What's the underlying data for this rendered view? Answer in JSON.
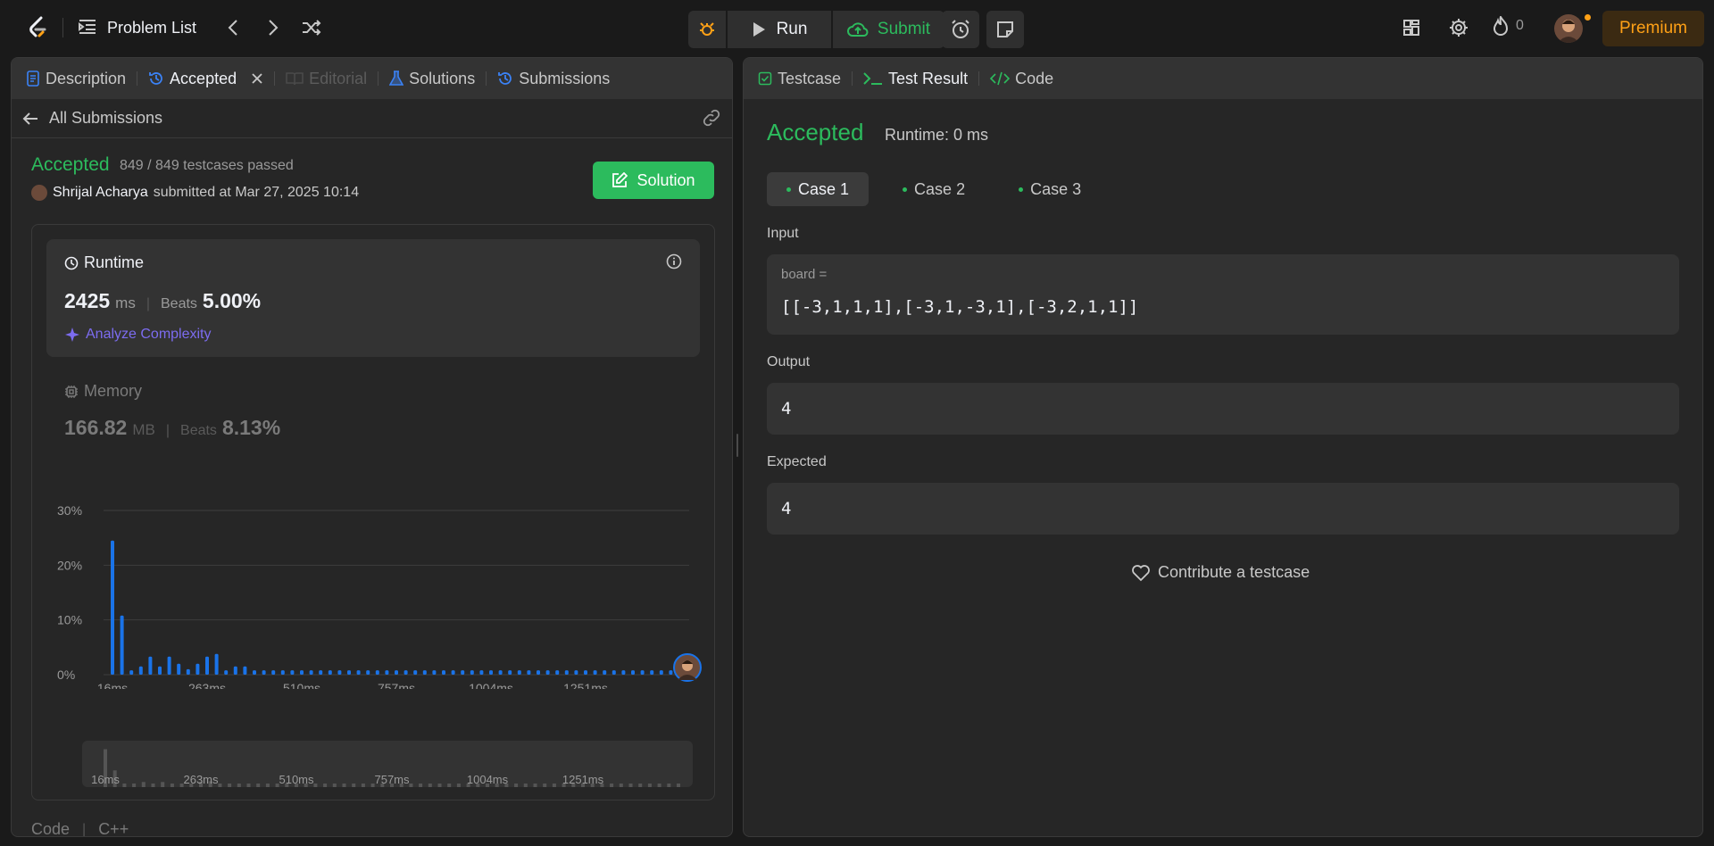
{
  "topbar": {
    "problem_list_label": "Problem List",
    "run_label": "Run",
    "submit_label": "Submit",
    "streak_count": "0",
    "premium_label": "Premium"
  },
  "left_tabs": [
    {
      "label": "Description",
      "icon": "description-icon"
    },
    {
      "label": "Accepted",
      "icon": "history-icon"
    },
    {
      "label": "Editorial",
      "icon": "book-icon"
    },
    {
      "label": "Solutions",
      "icon": "flask-icon"
    },
    {
      "label": "Submissions",
      "icon": "history-icon"
    }
  ],
  "submission": {
    "back_label": "All Submissions",
    "status": "Accepted",
    "passed": "849 / 849 testcases passed",
    "user": "Shrijal Acharya",
    "submitted_text": "submitted at Mar 27, 2025 10:14",
    "solution_label": "Solution"
  },
  "runtime": {
    "title": "Runtime",
    "value": "2425",
    "unit": "ms",
    "beats_label": "Beats",
    "beats_value": "5.00%",
    "analyze_label": "Analyze Complexity"
  },
  "memory": {
    "title": "Memory",
    "value": "166.82",
    "unit": "MB",
    "beats_label": "Beats",
    "beats_value": "8.13%"
  },
  "chart_data": {
    "type": "bar",
    "categories": [
      "16ms",
      "",
      "",
      "",
      "",
      "",
      "",
      "",
      "",
      "",
      "263ms",
      "",
      "",
      "",
      "",
      "",
      "",
      "",
      "",
      "",
      "510ms",
      "",
      "",
      "",
      "",
      "",
      "",
      "",
      "",
      "",
      "757ms",
      "",
      "",
      "",
      "",
      "",
      "",
      "",
      "",
      "",
      "1004ms",
      "",
      "",
      "",
      "",
      "",
      "",
      "",
      "",
      "",
      "1251ms",
      "",
      "",
      "",
      "",
      "",
      "",
      "",
      "",
      "",
      ""
    ],
    "values": [
      24.5,
      10.8,
      0.8,
      1.5,
      3.3,
      1.5,
      3.3,
      2.0,
      1.0,
      2.0,
      3.3,
      3.8,
      0.8,
      1.5,
      1.5,
      0.8,
      0.8,
      0.8,
      0.8,
      0.8,
      0.8,
      0.8,
      0.8,
      0.8,
      0.8,
      0.8,
      0.8,
      0.8,
      0.8,
      0.8,
      0.8,
      0.8,
      0.8,
      0.8,
      0.8,
      0.8,
      0.8,
      0.8,
      0.8,
      0.8,
      0.8,
      0.8,
      0.8,
      0.8,
      0.8,
      0.8,
      0.8,
      0.8,
      0.8,
      0.8,
      0.8,
      0.8,
      0.8,
      0.8,
      0.8,
      0.8,
      0.8,
      0.8,
      0.8,
      0.8,
      0.8
    ],
    "x_tick_labels": [
      "16ms",
      "263ms",
      "510ms",
      "757ms",
      "1004ms",
      "1251ms"
    ],
    "y_tick_labels": [
      "0%",
      "10%",
      "20%",
      "30%"
    ],
    "ylim": [
      0,
      30
    ],
    "grid": true,
    "color": "#1a73e8"
  },
  "code_footer": {
    "label": "Code",
    "lang": "C++"
  },
  "right_tabs": [
    {
      "label": "Testcase",
      "icon": "checkbox-icon"
    },
    {
      "label": "Test Result",
      "icon": "terminal-icon"
    },
    {
      "label": "Code",
      "icon": "code-icon"
    }
  ],
  "result": {
    "status": "Accepted",
    "runtime": "Runtime: 0 ms",
    "cases": [
      "Case 1",
      "Case 2",
      "Case 3"
    ],
    "input_label": "Input",
    "input_var": "board =",
    "input_value": "[[-3,1,1,1],[-3,1,-3,1],[-3,2,1,1]]",
    "output_label": "Output",
    "output_value": "4",
    "expected_label": "Expected",
    "expected_value": "4",
    "contribute_label": "Contribute a testcase"
  },
  "colors": {
    "accepted": "#2cbb5d",
    "accent_orange": "#ffa116",
    "bar_blue": "#1a73e8",
    "analyze_purple": "#7c6cf0"
  }
}
